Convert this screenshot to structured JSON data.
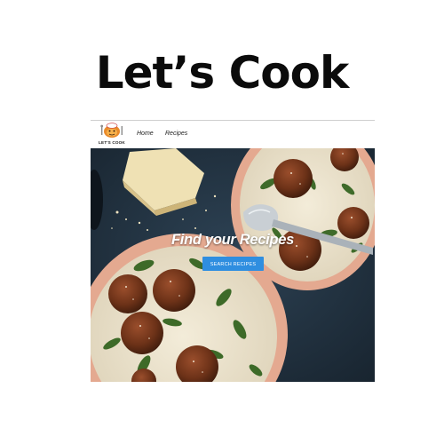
{
  "page": {
    "title": "Let’s Cook"
  },
  "site": {
    "logo_text": "LET'S COOK",
    "nav": [
      {
        "label": "Home"
      },
      {
        "label": "Recipes"
      }
    ]
  },
  "hero": {
    "heading": "Find your Recipes",
    "button_label": "SEARCH RECIPES"
  },
  "colors": {
    "button": "#2f8ee0",
    "hero_background": "#22313f",
    "bowl_rim": "#e4a990"
  },
  "icons": [
    "chef-logo-icon"
  ]
}
